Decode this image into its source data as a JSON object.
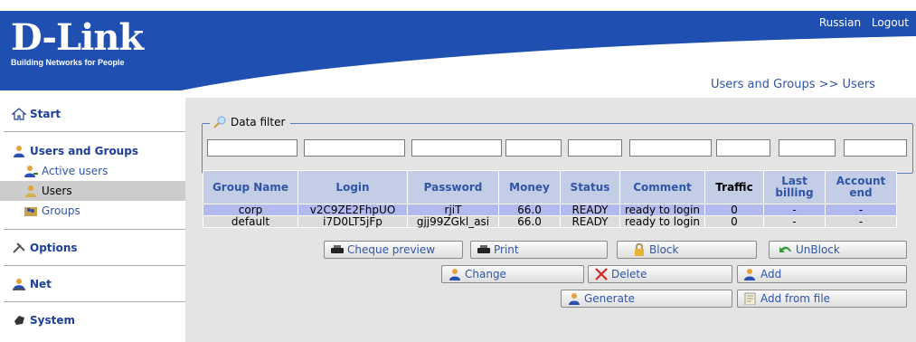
{
  "header": {
    "logo_text": "D-Link",
    "logo_tagline": "Building Networks for People",
    "brand_color": "#1e4fb1",
    "menu": [
      "Russian",
      "Logout"
    ],
    "breadcrumb": "Users and Groups >> Users"
  },
  "sidebar": {
    "sections": {
      "start": "Start",
      "users_groups": "Users and Groups",
      "options": "Options",
      "net": "Net",
      "system": "System"
    },
    "items": {
      "active_users": "Active users",
      "users": "Users",
      "groups": "Groups"
    },
    "active_item": "Users"
  },
  "filter": {
    "legend": "Data filter"
  },
  "table": {
    "headers": [
      "Group Name",
      "Login",
      "Password",
      "Money",
      "Status",
      "Comment",
      "Traffic",
      "Last billing",
      "Account end"
    ],
    "rows": [
      [
        "corp",
        "v2C9ZE2FhpUO",
        "rjiT",
        "66.0",
        "READY",
        "ready to login",
        "0",
        "-",
        "-"
      ],
      [
        "default",
        "i7D0LT5jFp",
        "gjj99ZGkl_asi",
        "66.0",
        "READY",
        "ready to login",
        "0",
        "-",
        "-"
      ]
    ]
  },
  "buttons": {
    "cheque_preview": "Cheque preview",
    "print": "Print",
    "block": "Block",
    "unblock": "UnBlock",
    "change": "Change",
    "delete": "Delete",
    "add": "Add",
    "generate": "Generate",
    "add_from_file": "Add from file"
  }
}
